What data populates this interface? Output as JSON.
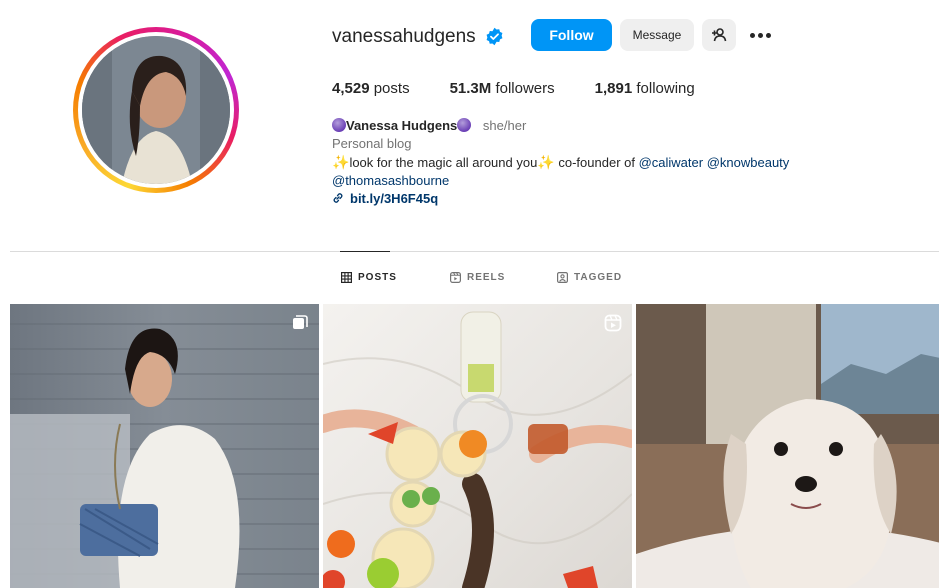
{
  "profile": {
    "username": "vanessahudgens",
    "verified_icon": "verified-badge-icon",
    "buttons": {
      "follow": "Follow",
      "message": "Message",
      "add_user_icon": "add-user-icon",
      "more_icon": "more-options-icon"
    },
    "stats": [
      {
        "value": "4,529",
        "label": "posts"
      },
      {
        "value": "51.3M",
        "label": "followers"
      },
      {
        "value": "1,891",
        "label": "following"
      }
    ],
    "bio": {
      "display_name": "Vanessa Hudgens",
      "pronouns": "she/her",
      "category": "Personal blog",
      "line1_prefix": "look for the magic all around you",
      "line1_middle": " co-founder of ",
      "tag1": "@caliwater",
      "tag2": "@knowbeauty",
      "tag3": "@thomasashbourne",
      "link": "bit.ly/3H6F45q"
    }
  },
  "tabs": [
    {
      "label": "POSTS",
      "icon": "grid-icon",
      "active": true
    },
    {
      "label": "REELS",
      "icon": "reels-icon",
      "active": false
    },
    {
      "label": "TAGGED",
      "icon": "tagged-icon",
      "active": false
    }
  ],
  "grid": [
    {
      "badge": "carousel-icon"
    },
    {
      "badge": "reel-icon"
    },
    {
      "badge": ""
    }
  ],
  "colors": {
    "accent": "#0095f6",
    "ring_start": "#fdd835",
    "ring_end": "#d81b9c",
    "link": "#00376b"
  }
}
